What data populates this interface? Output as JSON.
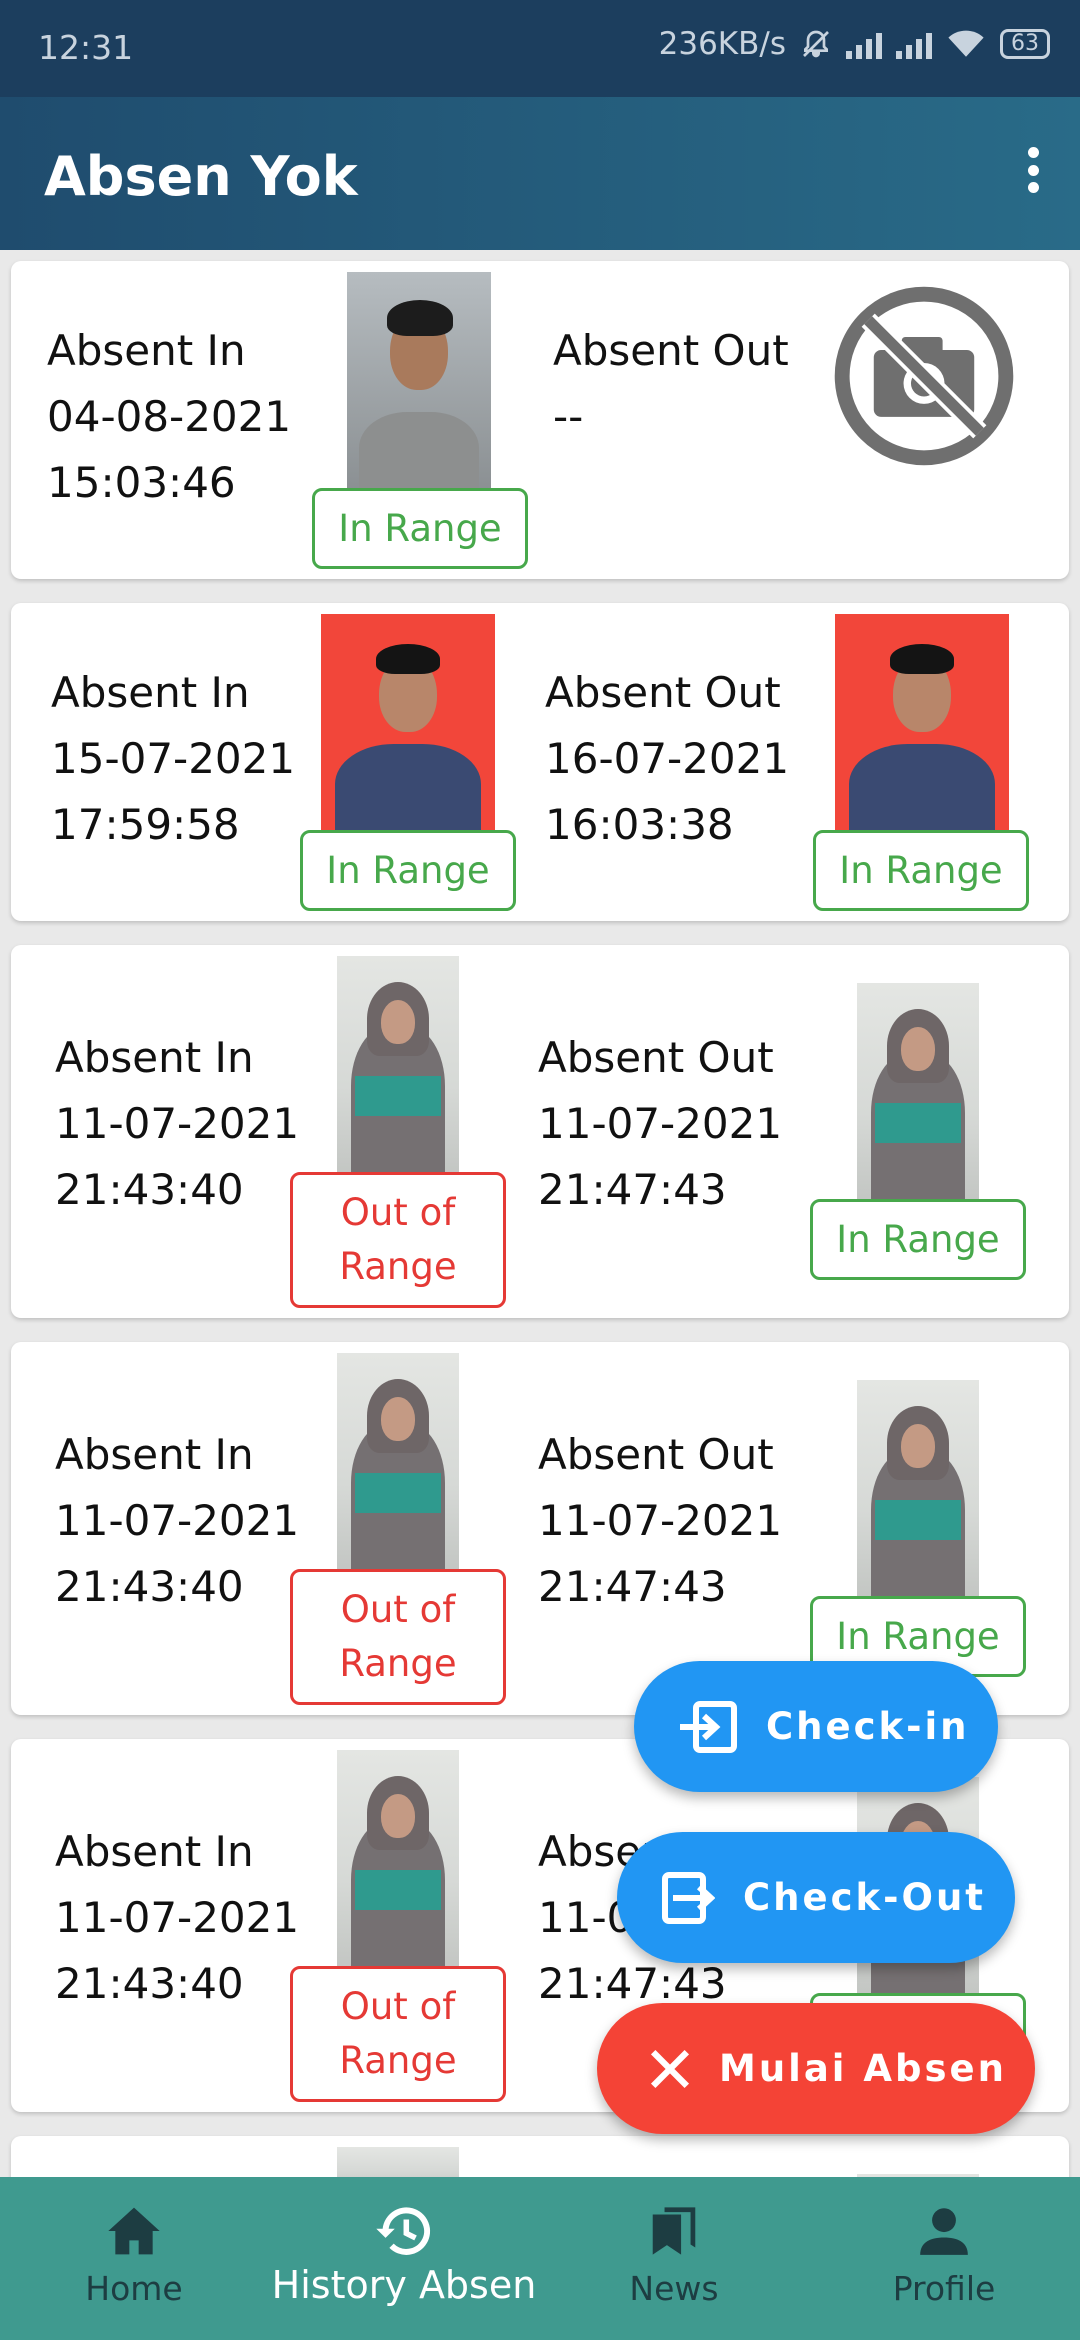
{
  "status_bar": {
    "time": "12:31",
    "network_speed": "236KB/s",
    "battery": "63"
  },
  "app_bar": {
    "title": "Absen Yok"
  },
  "records": [
    {
      "in_label": "Absent In",
      "in_date": "04-08-2021",
      "in_time": "15:03:46",
      "in_status": "In Range",
      "out_label": "Absent Out",
      "out_date": "--",
      "out_time": "",
      "out_status": ""
    },
    {
      "in_label": "Absent In",
      "in_date": "15-07-2021",
      "in_time": "17:59:58",
      "in_status": "In Range",
      "out_label": "Absent Out",
      "out_date": "16-07-2021",
      "out_time": "16:03:38",
      "out_status": "In Range"
    },
    {
      "in_label": "Absent In",
      "in_date": "11-07-2021",
      "in_time": "21:43:40",
      "in_status": "Out of Range",
      "out_label": "Absent Out",
      "out_date": "11-07-2021",
      "out_time": "21:47:43",
      "out_status": "In Range"
    },
    {
      "in_label": "Absent In",
      "in_date": "11-07-2021",
      "in_time": "21:43:40",
      "in_status": "Out of Range",
      "out_label": "Absent Out",
      "out_date": "11-07-2021",
      "out_time": "21:47:43",
      "out_status": "In Range"
    },
    {
      "in_label": "Absent In",
      "in_date": "11-07-2021",
      "in_time": "21:43:40",
      "in_status": "Out of Range",
      "out_label": "Absent Out",
      "out_date": "11-07-2021",
      "out_time": "21:47:43",
      "out_status": "In Range"
    }
  ],
  "fabs": {
    "check_in": "Check-in",
    "check_out": "Check-Out",
    "mulai_absen": "Mulai Absen"
  },
  "bottom_nav": [
    {
      "label": "Home",
      "icon": "home-icon",
      "active": false
    },
    {
      "label": "History Absen",
      "icon": "history-icon",
      "active": true
    },
    {
      "label": "News",
      "icon": "bookmarks-icon",
      "active": false
    },
    {
      "label": "Profile",
      "icon": "person-icon",
      "active": false
    }
  ],
  "colors": {
    "app_bar": "#1f4c6e",
    "in_range": "#47a84b",
    "out_of_range": "#e53935",
    "fab_blue": "#2196f3",
    "fab_red": "#f44336",
    "bottom_nav": "#3f9a8f"
  }
}
